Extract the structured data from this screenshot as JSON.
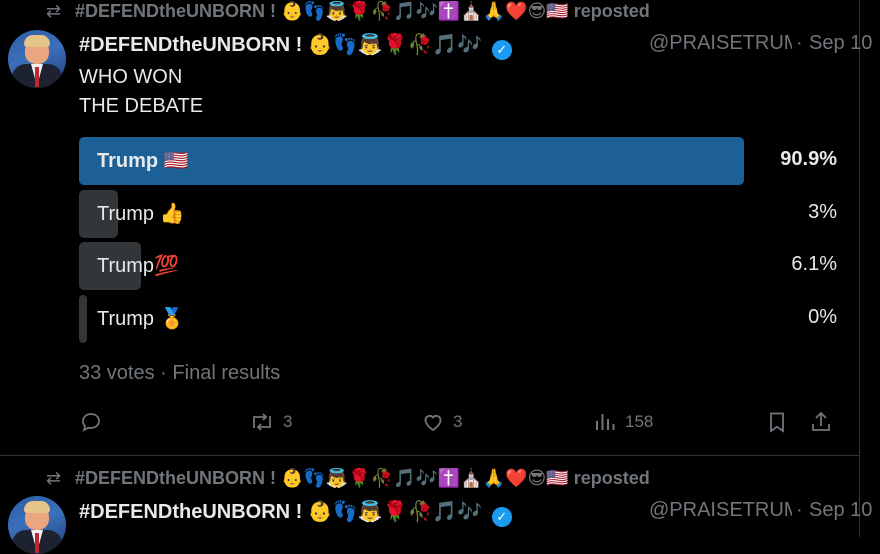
{
  "posts": [
    {
      "repost_by": "#DEFENDtheUNBORN ! 👶👣👼🌹🥀🎵🎶✝️⛪🙏❤️😎🇺🇸",
      "repost_suffix": "reposted",
      "display_name": "#DEFENDtheUNBORN ! 👶👣👼🌹🥀🎵🎶",
      "handle": "@PRAISETRUMP",
      "separator": "·",
      "date": "Sep 10",
      "more": "···",
      "text_lines": [
        "WHO WON",
        "THE DEBATE"
      ],
      "poll": {
        "options": [
          {
            "label": "Trump 🇺🇸",
            "percent_label": "90.9%",
            "percent": 90.9,
            "winner": true
          },
          {
            "label": "Trump 👍",
            "percent_label": "3%",
            "percent": 3,
            "winner": false
          },
          {
            "label": "Trump💯",
            "percent_label": "6.1%",
            "percent": 6.1,
            "winner": false
          },
          {
            "label": "Trump 🏅",
            "percent_label": "0%",
            "percent": 0,
            "winner": false
          }
        ],
        "votes": "33 votes",
        "dot": "·",
        "status": "Final results"
      },
      "actions": {
        "reply": "",
        "repost": "3",
        "like": "3",
        "views": "158"
      }
    },
    {
      "repost_by": "#DEFENDtheUNBORN ! 👶👣👼🌹🥀🎵🎶✝️⛪🙏❤️😎🇺🇸",
      "repost_suffix": "reposted",
      "display_name": "#DEFENDtheUNBORN ! 👶👣👼🌹🥀🎵🎶",
      "handle": "@PRAISETRUMP",
      "separator": "·",
      "date": "Sep 10",
      "more": "···"
    }
  ],
  "colors": {
    "background": "#000000",
    "poll_winner": "#1d6096",
    "poll_other": "#333639",
    "muted": "#71767b",
    "verified": "#1d9bf0"
  },
  "icons": {
    "repost": "repost-icon",
    "reply": "reply-icon",
    "like": "heart-icon",
    "views": "views-icon",
    "bookmark": "bookmark-icon",
    "share": "share-icon",
    "verified": "verified-badge-icon"
  }
}
